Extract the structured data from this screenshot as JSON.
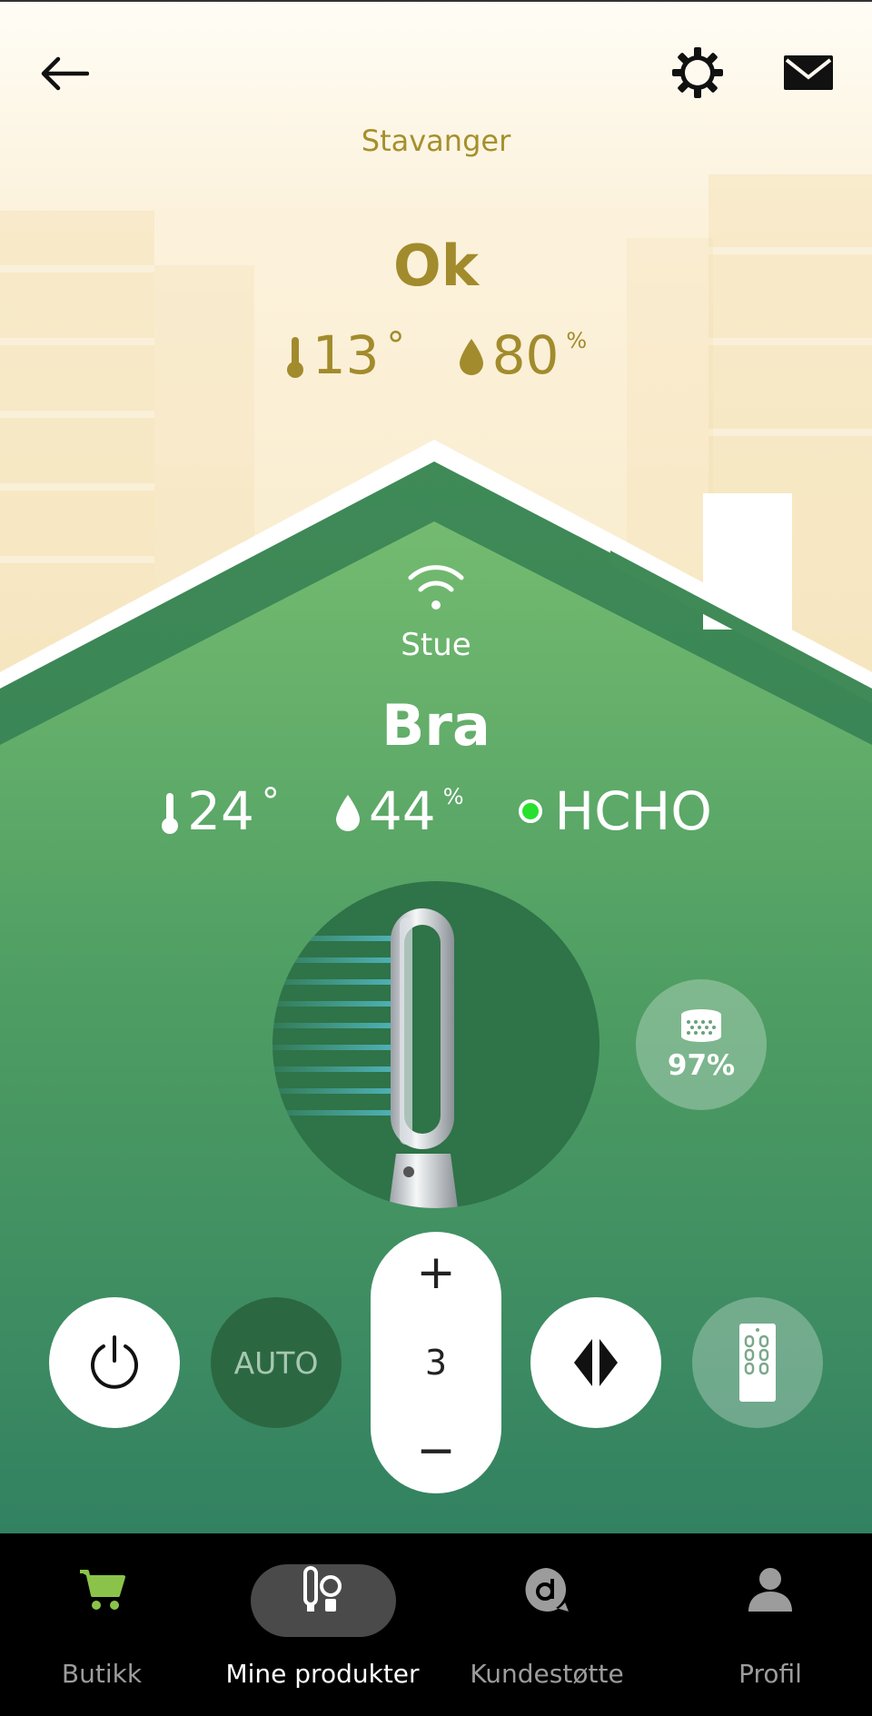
{
  "header": {
    "back_icon": "arrow-left-icon",
    "settings_icon": "gear-icon",
    "messages_icon": "mail-icon"
  },
  "outdoor": {
    "city": "Stavanger",
    "status": "Ok",
    "temperature": "13",
    "temperature_unit": "°",
    "humidity": "80",
    "humidity_unit": "%"
  },
  "indoor": {
    "room": "Stue",
    "status": "Bra",
    "temperature": "24",
    "temperature_unit": "°",
    "humidity": "44",
    "humidity_unit": "%",
    "pollutant_label": "HCHO",
    "pollutant_status_color": "#28e12e"
  },
  "device": {
    "filter_life": "97%"
  },
  "controls": {
    "auto_label": "AUTO",
    "speed_plus": "+",
    "speed_value": "3",
    "speed_minus": "−"
  },
  "nav": {
    "items": [
      {
        "label": "Butikk",
        "icon": "cart-icon"
      },
      {
        "label": "Mine produkter",
        "icon": "my-products-icon"
      },
      {
        "label": "Kundestøtte",
        "icon": "support-icon"
      },
      {
        "label": "Profil",
        "icon": "profile-icon"
      }
    ]
  },
  "colors": {
    "outdoor_text": "#a28b2c",
    "house_green_top": "#6fb86f",
    "house_green_bottom": "#348564",
    "accent_green": "#8bc34a"
  }
}
